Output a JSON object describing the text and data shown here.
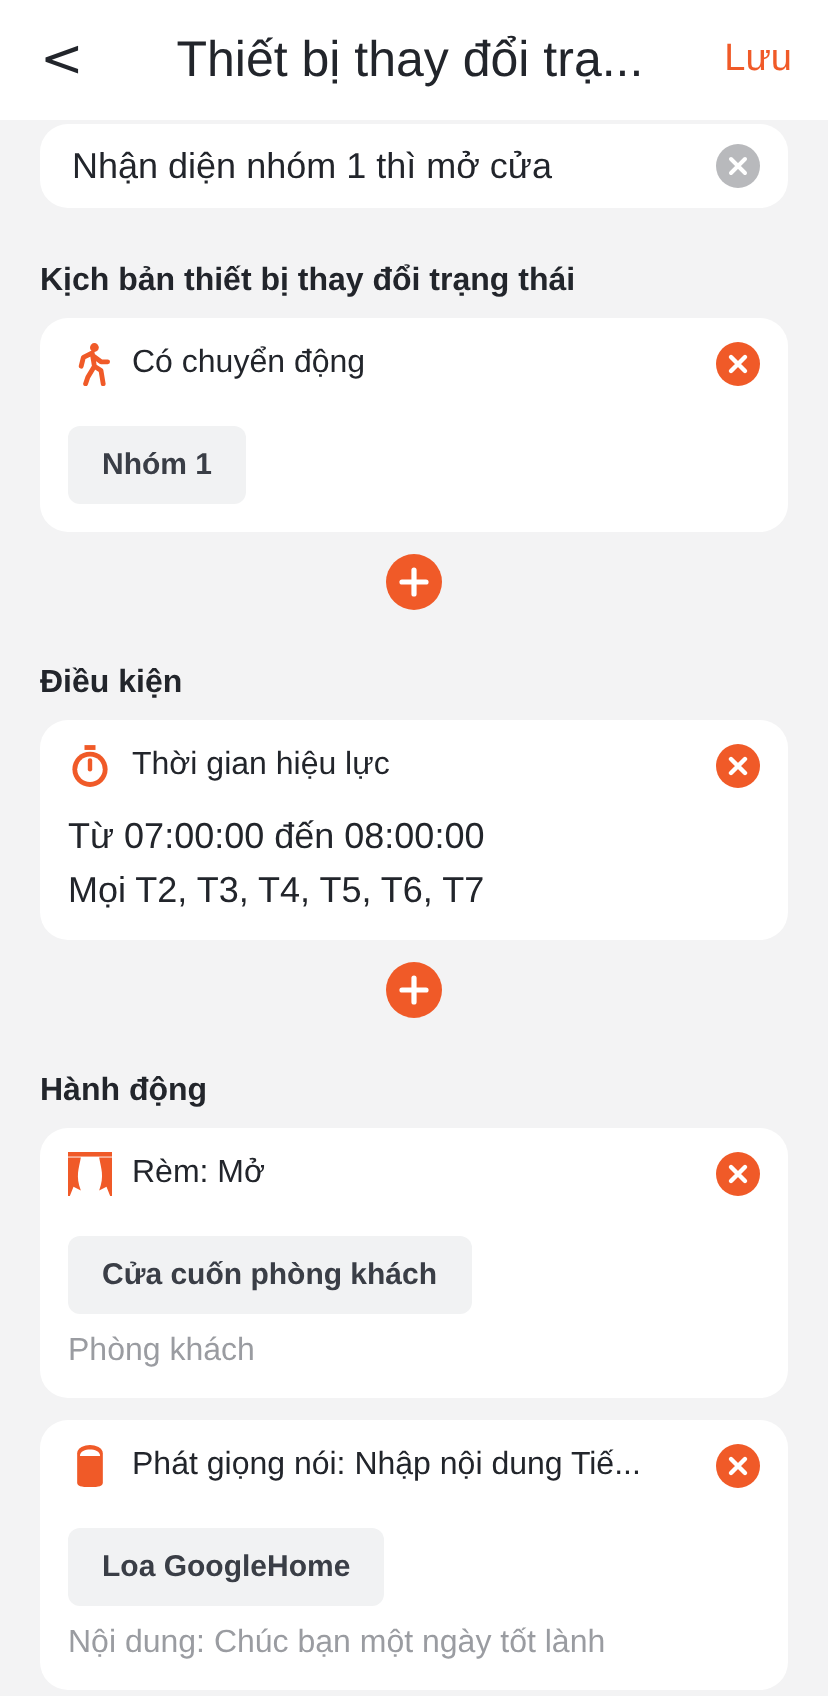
{
  "header": {
    "back": "<",
    "title": "Thiết bị thay đổi trạ...",
    "save": "Lưu"
  },
  "name_field": {
    "value": "Nhận diện nhóm 1 thì mở cửa"
  },
  "sections": [
    {
      "title": "Kịch bản thiết bị thay đổi trạng thái",
      "add_button": true,
      "cards": [
        {
          "kind": "motion",
          "title": "Có chuyển động",
          "chip": "Nhóm 1"
        }
      ]
    },
    {
      "title": "Điều kiện",
      "add_button": true,
      "cards": [
        {
          "kind": "timer",
          "title": "Thời gian hiệu lực",
          "lines": [
            "Từ 07:00:00 đến 08:00:00",
            "Mọi T2, T3, T4, T5, T6, T7"
          ]
        }
      ]
    },
    {
      "title": "Hành động",
      "add_button": false,
      "cards": [
        {
          "kind": "curtain",
          "title": "Rèm: Mở",
          "chip": "Cửa cuốn phòng khách",
          "note": "Phòng khách"
        },
        {
          "kind": "speaker",
          "title": "Phát giọng nói: Nhập nội dung Tiế...",
          "chip": "Loa GoogleHome",
          "note": "Nội dung: Chúc bạn một ngày tốt lành"
        }
      ]
    }
  ]
}
